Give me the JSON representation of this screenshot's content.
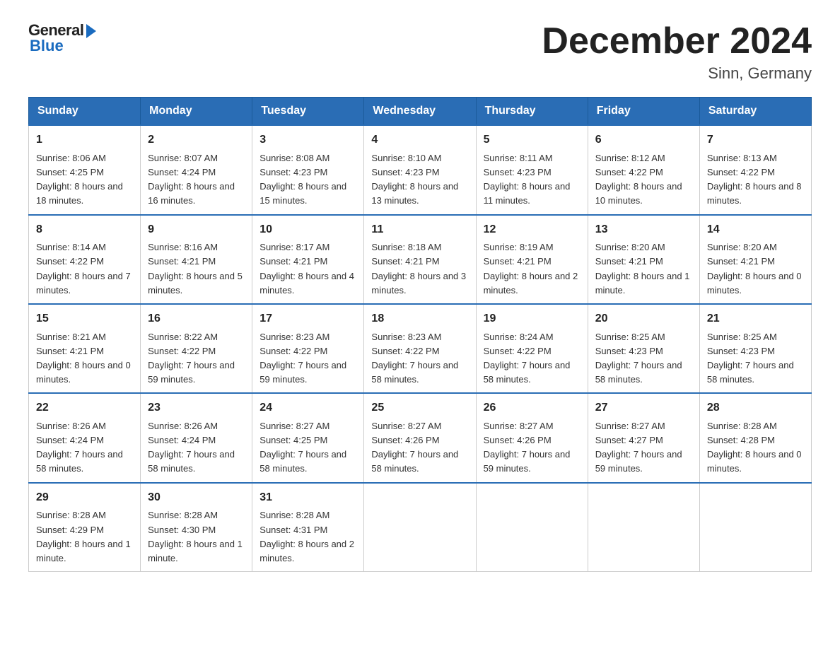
{
  "logo": {
    "general": "General",
    "blue": "Blue"
  },
  "title": "December 2024",
  "subtitle": "Sinn, Germany",
  "weekdays": [
    "Sunday",
    "Monday",
    "Tuesday",
    "Wednesday",
    "Thursday",
    "Friday",
    "Saturday"
  ],
  "weeks": [
    [
      {
        "day": "1",
        "sunrise": "8:06 AM",
        "sunset": "4:25 PM",
        "daylight": "8 hours and 18 minutes."
      },
      {
        "day": "2",
        "sunrise": "8:07 AM",
        "sunset": "4:24 PM",
        "daylight": "8 hours and 16 minutes."
      },
      {
        "day": "3",
        "sunrise": "8:08 AM",
        "sunset": "4:23 PM",
        "daylight": "8 hours and 15 minutes."
      },
      {
        "day": "4",
        "sunrise": "8:10 AM",
        "sunset": "4:23 PM",
        "daylight": "8 hours and 13 minutes."
      },
      {
        "day": "5",
        "sunrise": "8:11 AM",
        "sunset": "4:23 PM",
        "daylight": "8 hours and 11 minutes."
      },
      {
        "day": "6",
        "sunrise": "8:12 AM",
        "sunset": "4:22 PM",
        "daylight": "8 hours and 10 minutes."
      },
      {
        "day": "7",
        "sunrise": "8:13 AM",
        "sunset": "4:22 PM",
        "daylight": "8 hours and 8 minutes."
      }
    ],
    [
      {
        "day": "8",
        "sunrise": "8:14 AM",
        "sunset": "4:22 PM",
        "daylight": "8 hours and 7 minutes."
      },
      {
        "day": "9",
        "sunrise": "8:16 AM",
        "sunset": "4:21 PM",
        "daylight": "8 hours and 5 minutes."
      },
      {
        "day": "10",
        "sunrise": "8:17 AM",
        "sunset": "4:21 PM",
        "daylight": "8 hours and 4 minutes."
      },
      {
        "day": "11",
        "sunrise": "8:18 AM",
        "sunset": "4:21 PM",
        "daylight": "8 hours and 3 minutes."
      },
      {
        "day": "12",
        "sunrise": "8:19 AM",
        "sunset": "4:21 PM",
        "daylight": "8 hours and 2 minutes."
      },
      {
        "day": "13",
        "sunrise": "8:20 AM",
        "sunset": "4:21 PM",
        "daylight": "8 hours and 1 minute."
      },
      {
        "day": "14",
        "sunrise": "8:20 AM",
        "sunset": "4:21 PM",
        "daylight": "8 hours and 0 minutes."
      }
    ],
    [
      {
        "day": "15",
        "sunrise": "8:21 AM",
        "sunset": "4:21 PM",
        "daylight": "8 hours and 0 minutes."
      },
      {
        "day": "16",
        "sunrise": "8:22 AM",
        "sunset": "4:22 PM",
        "daylight": "7 hours and 59 minutes."
      },
      {
        "day": "17",
        "sunrise": "8:23 AM",
        "sunset": "4:22 PM",
        "daylight": "7 hours and 59 minutes."
      },
      {
        "day": "18",
        "sunrise": "8:23 AM",
        "sunset": "4:22 PM",
        "daylight": "7 hours and 58 minutes."
      },
      {
        "day": "19",
        "sunrise": "8:24 AM",
        "sunset": "4:22 PM",
        "daylight": "7 hours and 58 minutes."
      },
      {
        "day": "20",
        "sunrise": "8:25 AM",
        "sunset": "4:23 PM",
        "daylight": "7 hours and 58 minutes."
      },
      {
        "day": "21",
        "sunrise": "8:25 AM",
        "sunset": "4:23 PM",
        "daylight": "7 hours and 58 minutes."
      }
    ],
    [
      {
        "day": "22",
        "sunrise": "8:26 AM",
        "sunset": "4:24 PM",
        "daylight": "7 hours and 58 minutes."
      },
      {
        "day": "23",
        "sunrise": "8:26 AM",
        "sunset": "4:24 PM",
        "daylight": "7 hours and 58 minutes."
      },
      {
        "day": "24",
        "sunrise": "8:27 AM",
        "sunset": "4:25 PM",
        "daylight": "7 hours and 58 minutes."
      },
      {
        "day": "25",
        "sunrise": "8:27 AM",
        "sunset": "4:26 PM",
        "daylight": "7 hours and 58 minutes."
      },
      {
        "day": "26",
        "sunrise": "8:27 AM",
        "sunset": "4:26 PM",
        "daylight": "7 hours and 59 minutes."
      },
      {
        "day": "27",
        "sunrise": "8:27 AM",
        "sunset": "4:27 PM",
        "daylight": "7 hours and 59 minutes."
      },
      {
        "day": "28",
        "sunrise": "8:28 AM",
        "sunset": "4:28 PM",
        "daylight": "8 hours and 0 minutes."
      }
    ],
    [
      {
        "day": "29",
        "sunrise": "8:28 AM",
        "sunset": "4:29 PM",
        "daylight": "8 hours and 1 minute."
      },
      {
        "day": "30",
        "sunrise": "8:28 AM",
        "sunset": "4:30 PM",
        "daylight": "8 hours and 1 minute."
      },
      {
        "day": "31",
        "sunrise": "8:28 AM",
        "sunset": "4:31 PM",
        "daylight": "8 hours and 2 minutes."
      },
      null,
      null,
      null,
      null
    ]
  ],
  "labels": {
    "sunrise": "Sunrise:",
    "sunset": "Sunset:",
    "daylight": "Daylight:"
  }
}
